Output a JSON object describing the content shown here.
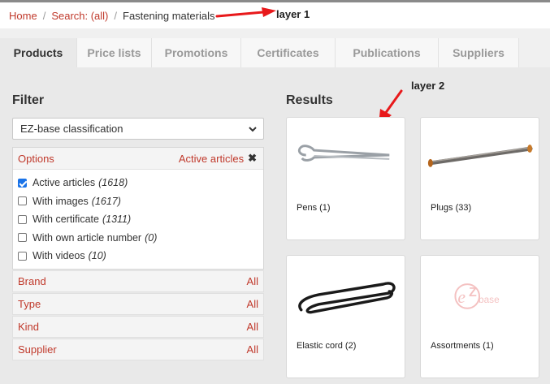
{
  "breadcrumb": {
    "home": "Home",
    "search": "Search: (all)",
    "current": "Fastening materials"
  },
  "annotations": {
    "layer1": "layer 1",
    "layer2": "layer 2",
    "arrow_color": "#e8191b"
  },
  "tabs": [
    {
      "label": "Products",
      "active": true
    },
    {
      "label": "Price lists",
      "active": false
    },
    {
      "label": "Promotions",
      "active": false
    },
    {
      "label": "Certificates",
      "active": false
    },
    {
      "label": "Publications",
      "active": false
    },
    {
      "label": "Suppliers",
      "active": false
    }
  ],
  "filter": {
    "title": "Filter",
    "classification": "EZ-base classification",
    "options_label": "Options",
    "active_label": "Active articles",
    "options": [
      {
        "label": "Active articles",
        "count": "(1618)",
        "checked": true
      },
      {
        "label": "With images",
        "count": "(1617)",
        "checked": false
      },
      {
        "label": "With certificate",
        "count": "(1311)",
        "checked": false
      },
      {
        "label": "With own article number",
        "count": "(0)",
        "checked": false
      },
      {
        "label": "With videos",
        "count": "(10)",
        "checked": false
      }
    ],
    "facets": [
      {
        "label": "Brand",
        "value": "All"
      },
      {
        "label": "Type",
        "value": "All"
      },
      {
        "label": "Kind",
        "value": "All"
      },
      {
        "label": "Supplier",
        "value": "All"
      }
    ]
  },
  "results": {
    "title": "Results",
    "items": [
      {
        "label": "Pens (1)",
        "icon": "cotter-pin-image"
      },
      {
        "label": "Plugs (33)",
        "icon": "anchor-plug-image"
      },
      {
        "label": "Elastic cord (2)",
        "icon": "elastic-cord-image"
      },
      {
        "label": "Assortments (1)",
        "icon": "ezbase-logo-image"
      }
    ]
  },
  "colors": {
    "accent": "#c0392b",
    "checkbox": "#1a73e8",
    "panel_bg": "#e9e9e9"
  }
}
